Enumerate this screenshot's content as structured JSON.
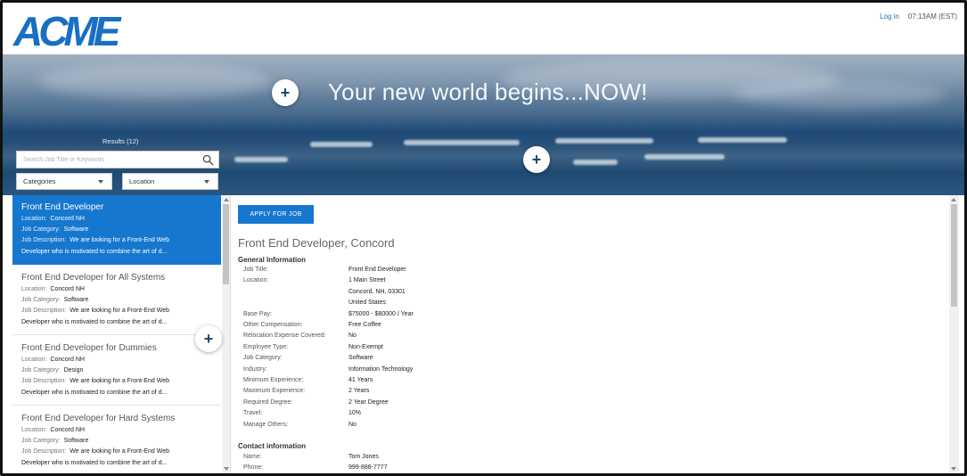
{
  "header": {
    "logo_text": "ACME",
    "login_label": "Log in",
    "time": "07:13AM (EST)"
  },
  "hero": {
    "title": "Your new world begins...NOW!",
    "results_label": "Results (12)",
    "search_placeholder": "Search Job Title or Keywords",
    "categories_label": "Categories",
    "location_label": "Location",
    "plus_symbol": "+"
  },
  "colors": {
    "accent": "#1677cf",
    "logo": "#1a6fc4"
  },
  "jobs": [
    {
      "title": "Front End Developer",
      "location_key": "Location:",
      "location": "Concord NH",
      "category_key": "Job Category:",
      "category": "Software",
      "desc_key": "Job Description:",
      "desc1": "We are looking for a Front-End Web",
      "desc2": "Developer who is motivated to combine the art of d..."
    },
    {
      "title": "Front End Developer for All Systems",
      "location_key": "Location:",
      "location": "Concord NH",
      "category_key": "Job Category:",
      "category": "Software",
      "desc_key": "Job Description:",
      "desc1": "We are looking for a Front-End Web",
      "desc2": "Developer who is motivated to combine the art of d..."
    },
    {
      "title": "Front End Developer for Dummies",
      "location_key": "Location:",
      "location": "Concord NH",
      "category_key": "Job Category:",
      "category": "Design",
      "desc_key": "Job Description:",
      "desc1": "We are looking for a Front-End Web",
      "desc2": "Developer who is motivated to combine the art of d..."
    },
    {
      "title": "Front End Developer for Hard Systems",
      "location_key": "Location:",
      "location": "Concord NH",
      "category_key": "Job Category:",
      "category": "Software",
      "desc_key": "Job Description:",
      "desc1": "We are looking for a Front-End Web",
      "desc2": "Developer who is motivated to combine the art of d..."
    }
  ],
  "detail": {
    "apply_label": "APPLY FOR JOB",
    "title": "Front End Developer, Concord",
    "general_heading": "General Information",
    "general": [
      {
        "k": "Job Title:",
        "v": "Front End Developer"
      },
      {
        "k": "Location:",
        "v": "1 Main Street"
      },
      {
        "k": "",
        "v": "Concord, NH, 03301"
      },
      {
        "k": "",
        "v": "United States"
      },
      {
        "k": "Base Pay:",
        "v": "$75000 - $80000 / Year"
      },
      {
        "k": "Other Compensation:",
        "v": "Free Coffee"
      },
      {
        "k": "Relocation Expense Covered:",
        "v": "No"
      },
      {
        "k": "Employee Type:",
        "v": "Non-Exempt"
      },
      {
        "k": "Job Category:",
        "v": "Software"
      },
      {
        "k": "Industry:",
        "v": "Information Technology"
      },
      {
        "k": "Minimum Experience:",
        "v": "41 Years"
      },
      {
        "k": "Maximum Experience:",
        "v": "2 Years"
      },
      {
        "k": "Required Degree:",
        "v": "2 Year Degree"
      },
      {
        "k": "Travel:",
        "v": "10%"
      },
      {
        "k": "Manage Others:",
        "v": "No"
      }
    ],
    "contact_heading": "Contact information",
    "contact": [
      {
        "k": "Name:",
        "v": "Tom Jones"
      },
      {
        "k": "Phone:",
        "v": "999-888-7777"
      }
    ]
  }
}
